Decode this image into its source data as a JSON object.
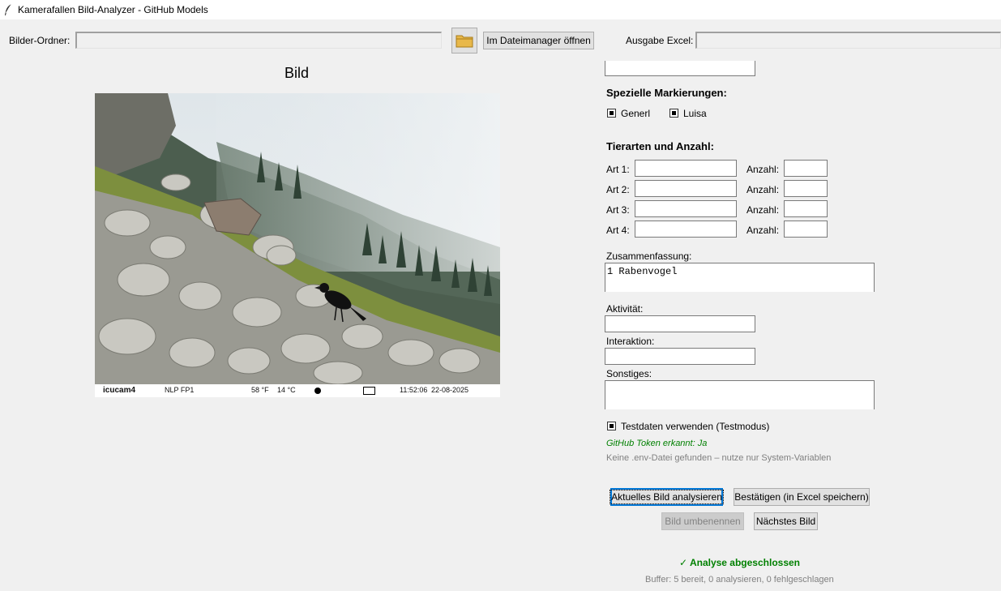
{
  "window": {
    "title": "Kamerafallen Bild-Analyzer - GitHub Models"
  },
  "top": {
    "folder_label": "Bilder-Ordner:",
    "folder_value": "",
    "open_filemanager_label": "Im Dateimanager öffnen",
    "excel_label": "Ausgabe Excel:",
    "excel_value": ""
  },
  "image_panel": {
    "title": "Bild",
    "camera_strip": {
      "brand": "icucam4",
      "location": "NLP FP1",
      "temp_f": "58 °F",
      "temp_c": "14 °C",
      "time": "11:52:06",
      "date": "22-08-2025"
    }
  },
  "special_marks": {
    "heading": "Spezielle Markierungen:",
    "items": [
      {
        "label": "Generl",
        "checked": true
      },
      {
        "label": "Luisa",
        "checked": true
      }
    ]
  },
  "species": {
    "heading": "Tierarten und Anzahl:",
    "count_label": "Anzahl:",
    "rows": [
      {
        "label": "Art 1:",
        "value": "",
        "count": ""
      },
      {
        "label": "Art 2:",
        "value": "",
        "count": ""
      },
      {
        "label": "Art 3:",
        "value": "",
        "count": ""
      },
      {
        "label": "Art 4:",
        "value": "",
        "count": ""
      }
    ]
  },
  "summary": {
    "label": "Zusammenfassung:",
    "value": "1 Rabenvogel"
  },
  "activity": {
    "label": "Aktivität:",
    "value": ""
  },
  "interaction": {
    "label": "Interaktion:",
    "value": ""
  },
  "misc": {
    "label": "Sonstiges:",
    "value": ""
  },
  "test_mode": {
    "label": "Testdaten verwenden (Testmodus)",
    "checked": true
  },
  "status": {
    "token_text": "GitHub Token erkannt: Ja",
    "token_color": "#008000",
    "env_text": "Keine .env-Datei gefunden – nutze nur System-Variablen",
    "analysis_done": "✓ Analyse abgeschlossen",
    "analysis_color": "#008000",
    "buffer_text": "Buffer: 5 bereit, 0 analysieren, 0 fehlgeschlagen"
  },
  "actions": {
    "analyze_label": "Aktuelles Bild analysieren",
    "confirm_label": "Bestätigen (in Excel speichern)",
    "rename_label": "Bild umbenennen",
    "next_label": "Nächstes Bild"
  }
}
